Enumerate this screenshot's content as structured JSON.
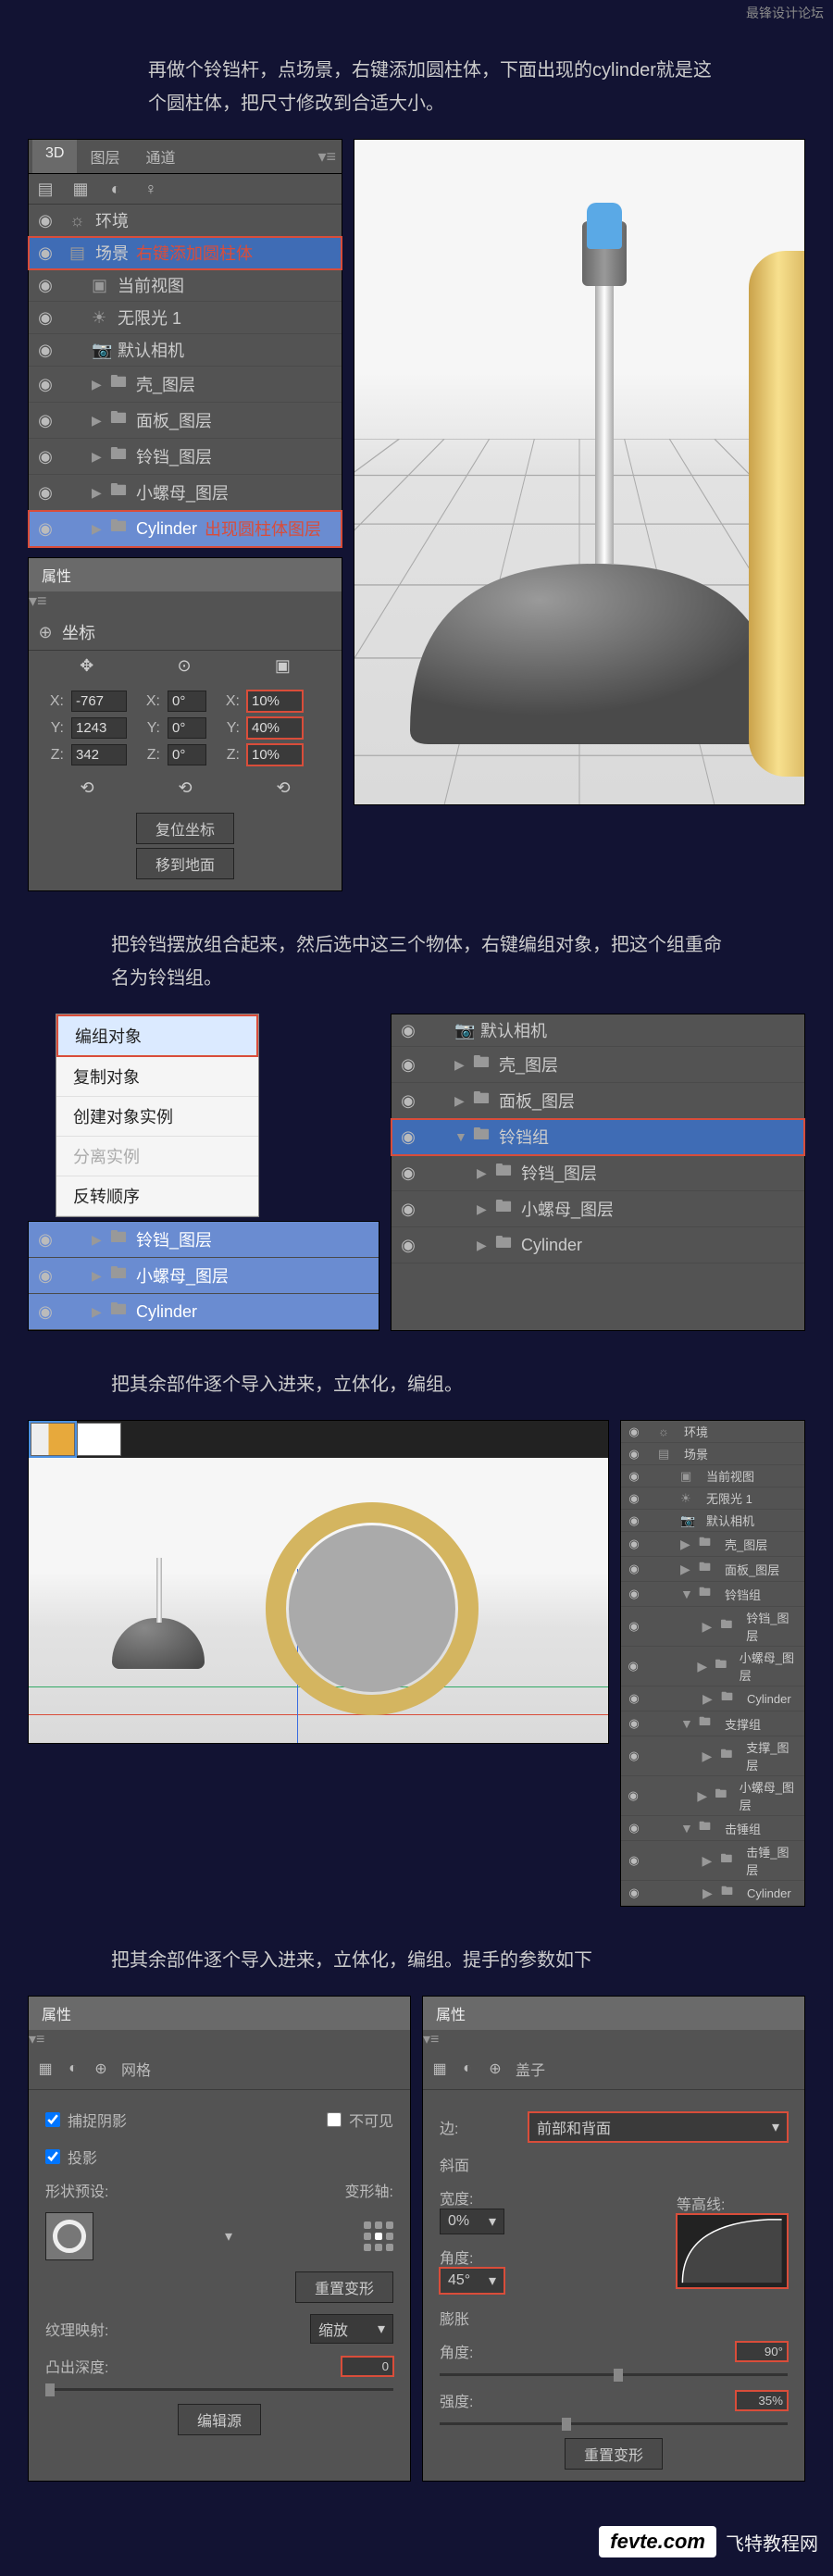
{
  "watermark_top": "最锋设计论坛",
  "captions": {
    "c1": "再做个铃铛杆，点场景，右键添加圆柱体，下面出现的cylinder就是这个圆柱体，把尺寸修改到合适大小。",
    "c2": "把铃铛摆放组合起来，然后选中这三个物体，右键编组对象，把这个组重命名为铃铛组。",
    "c3": "把其余部件逐个导入进来，立体化，编组。",
    "c4": "把其余部件逐个导入进来，立体化，编组。提手的参数如下"
  },
  "panel1": {
    "tabs": [
      "3D",
      "图层",
      "通道"
    ],
    "tree": [
      {
        "eye": "◉",
        "ico": "☼",
        "label": "环境"
      },
      {
        "eye": "◉",
        "ico": "▤",
        "label": "场景",
        "note": "右键添加圆柱体",
        "hl": true,
        "red": true
      },
      {
        "eye": "◉",
        "ico": "▣",
        "label": "当前视图",
        "nested": 1
      },
      {
        "eye": "◉",
        "ico": "☀",
        "label": "无限光 1",
        "nested": 1
      },
      {
        "eye": "◉",
        "ico": "📷",
        "label": "默认相机",
        "nested": 1
      },
      {
        "eye": "◉",
        "ico": "▸",
        "label": "壳_图层",
        "nested": 1,
        "arrow": "▶",
        "folder": true
      },
      {
        "eye": "◉",
        "ico": "▸",
        "label": "面板_图层",
        "nested": 1,
        "arrow": "▶",
        "folder": true
      },
      {
        "eye": "◉",
        "ico": "▸",
        "label": "铃铛_图层",
        "nested": 1,
        "arrow": "▶",
        "folder": true
      },
      {
        "eye": "◉",
        "ico": "▸",
        "label": "小螺母_图层",
        "nested": 1,
        "arrow": "▶",
        "folder": true
      },
      {
        "eye": "◉",
        "ico": "▸",
        "label": "Cylinder",
        "note": "出现圆柱体图层",
        "nested": 1,
        "arrow": "▶",
        "folder": true,
        "hl": true,
        "hlblue": true,
        "red": true
      }
    ]
  },
  "props": {
    "title": "属性",
    "sub": "坐标",
    "rows": [
      {
        "l": "X:",
        "v1": "-767",
        "l2": "X:",
        "v2": "0°",
        "l3": "X:",
        "v3": "10%"
      },
      {
        "l": "Y:",
        "v1": "1243",
        "l2": "Y:",
        "v2": "0°",
        "l3": "Y:",
        "v3": "40%"
      },
      {
        "l": "Z:",
        "v1": "342",
        "l2": "Z:",
        "v2": "0°",
        "l3": "Z:",
        "v3": "10%"
      }
    ],
    "reset_icons": [
      "⟲",
      "⟲",
      "⟲"
    ],
    "btn_reset": "复位坐标",
    "btn_ground": "移到地面"
  },
  "ctx_menu": [
    "编组对象",
    "复制对象",
    "创建对象实例",
    "分离实例",
    "反转顺序"
  ],
  "panel2_below": [
    {
      "label": "铃铛_图层",
      "hl": true,
      "arrow": "▶",
      "folder": true
    },
    {
      "label": "小螺母_图层",
      "hl": true,
      "arrow": "▶",
      "folder": true
    },
    {
      "label": "Cylinder",
      "hl": true,
      "arrow": "▶",
      "folder": true
    }
  ],
  "panel2_right": [
    {
      "eye": "◉",
      "ico": "📷",
      "label": "默认相机",
      "nested": 1
    },
    {
      "eye": "◉",
      "arrow": "▶",
      "folder": true,
      "label": "壳_图层",
      "nested": 1
    },
    {
      "eye": "◉",
      "arrow": "▶",
      "folder": true,
      "label": "面板_图层",
      "nested": 1
    },
    {
      "eye": "◉",
      "arrow": "▼",
      "folder": true,
      "label": "铃铛组",
      "nested": 1,
      "hl": true,
      "red": true
    },
    {
      "eye": "◉",
      "arrow": "▶",
      "folder": true,
      "label": "铃铛_图层",
      "nested": 2
    },
    {
      "eye": "◉",
      "arrow": "▶",
      "folder": true,
      "label": "小螺母_图层",
      "nested": 2
    },
    {
      "eye": "◉",
      "arrow": "▶",
      "folder": true,
      "label": "Cylinder",
      "nested": 2
    }
  ],
  "panel3_tree": [
    {
      "eye": "◉",
      "ico": "☼",
      "label": "环境"
    },
    {
      "eye": "◉",
      "ico": "▤",
      "label": "场景"
    },
    {
      "eye": "◉",
      "ico": "▣",
      "label": "当前视图",
      "nested": 1
    },
    {
      "eye": "◉",
      "ico": "☀",
      "label": "无限光 1",
      "nested": 1
    },
    {
      "eye": "◉",
      "ico": "📷",
      "label": "默认相机",
      "nested": 1
    },
    {
      "eye": "◉",
      "arrow": "▶",
      "folder": true,
      "label": "壳_图层",
      "nested": 1
    },
    {
      "eye": "◉",
      "arrow": "▶",
      "folder": true,
      "label": "面板_图层",
      "nested": 1
    },
    {
      "eye": "◉",
      "arrow": "▼",
      "folder": true,
      "label": "铃铛组",
      "nested": 1,
      "hlblue": true
    },
    {
      "eye": "◉",
      "arrow": "▶",
      "folder": true,
      "label": "铃铛_图层",
      "nested": 2
    },
    {
      "eye": "◉",
      "arrow": "▶",
      "folder": true,
      "label": "小螺母_图层",
      "nested": 2
    },
    {
      "eye": "◉",
      "arrow": "▶",
      "folder": true,
      "label": "Cylinder",
      "nested": 2
    },
    {
      "eye": "◉",
      "arrow": "▼",
      "folder": true,
      "label": "支撑组",
      "nested": 1
    },
    {
      "eye": "◉",
      "arrow": "▶",
      "folder": true,
      "label": "支撑_图层",
      "nested": 2
    },
    {
      "eye": "◉",
      "arrow": "▶",
      "folder": true,
      "label": "小螺母_图层",
      "nested": 2
    },
    {
      "eye": "◉",
      "arrow": "▼",
      "folder": true,
      "label": "击锤组",
      "nested": 1
    },
    {
      "eye": "◉",
      "arrow": "▶",
      "folder": true,
      "label": "击锤_图层",
      "nested": 2
    },
    {
      "eye": "◉",
      "arrow": "▶",
      "folder": true,
      "label": "Cylinder",
      "nested": 2
    }
  ],
  "left_prop": {
    "title": "属性",
    "mode": "网格",
    "chk_capture_shadow": "捕捉阴影",
    "chk_invisible": "不可见",
    "chk_cast": "投影",
    "shape_preset": "形状预设:",
    "deform_axis": "变形轴:",
    "reset_deform": "重置变形",
    "tex_map": "纹理映射:",
    "tex_value": "缩放",
    "extrude": "凸出深度:",
    "extrude_v": "0",
    "edit_src": "编辑源"
  },
  "right_prop": {
    "title": "属性",
    "mode": "盖子",
    "edge_label": "边:",
    "edge_value": "前部和背面",
    "bevel": "斜面",
    "width": "宽度:",
    "width_v": "0%",
    "contour": "等高线:",
    "angle": "角度:",
    "angle_v": "45°",
    "inflate": "膨胀",
    "inflate_angle": "角度:",
    "inflate_angle_v": "90°",
    "strength": "强度:",
    "strength_v": "35%",
    "reset_deform": "重置变形"
  },
  "footer": {
    "logo": "fevte.com",
    "text": "飞特教程网"
  }
}
